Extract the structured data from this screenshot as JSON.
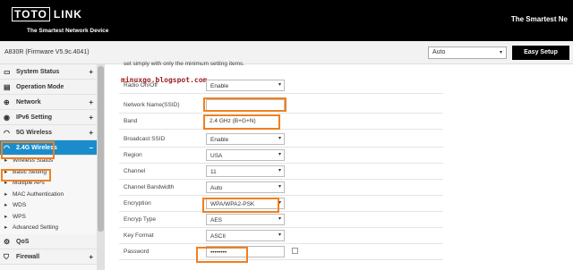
{
  "header": {
    "logo_left": "TOTO",
    "logo_right": "LINK",
    "logo_sub": "The Smartest Network Device",
    "right_title": "The Smartest Ne"
  },
  "subbar": {
    "model": "A830R (Firmware V5.9c.4041)",
    "language": "Auto",
    "easy_setup": "Easy Setup"
  },
  "sidebar": {
    "items": [
      {
        "label": "System Status",
        "icon": "monitor-icon"
      },
      {
        "label": "Operation Mode",
        "icon": "mode-icon"
      },
      {
        "label": "Network",
        "icon": "globe-icon"
      },
      {
        "label": "IPv6 Setting",
        "icon": "ipv6-icon"
      },
      {
        "label": "5G Wireless",
        "icon": "wifi-icon"
      },
      {
        "label": "2.4G Wireless",
        "icon": "wifi-icon"
      },
      {
        "label": "QoS",
        "icon": "gear-icon"
      },
      {
        "label": "Firewall",
        "icon": "shield-icon"
      }
    ],
    "plus": "+",
    "minus": "−",
    "bullet": "▸",
    "subitems": [
      "Wireless Status",
      "Basic Setting",
      "Multiple APs",
      "MAC Authentication",
      "WDS",
      "WPS",
      "Advanced Setting"
    ]
  },
  "main": {
    "intro": "set simply with only the minimum setting items.",
    "watermark": "minuxgo.blogspot.com",
    "rows": [
      {
        "label": "Radio On/Off",
        "value": "Enable",
        "dropdown": true
      },
      {
        "label": "Network Name(SSID)",
        "value": "",
        "dropdown": false
      },
      {
        "label": "Band",
        "value": "2.4 GHz (B+G+N)",
        "dropdown": false
      },
      {
        "label": "Broadcast SSID",
        "value": "Enable",
        "dropdown": true
      },
      {
        "label": "Region",
        "value": "USA",
        "dropdown": true
      },
      {
        "label": "Channel",
        "value": "11",
        "dropdown": true
      },
      {
        "label": "Channel Bandwidth",
        "value": "Auto",
        "dropdown": true
      },
      {
        "label": "Encryption",
        "value": "WPA/WPA2-PSK",
        "dropdown": true
      },
      {
        "label": "Encryp Type",
        "value": "AES",
        "dropdown": true
      },
      {
        "label": "Key Format",
        "value": "ASCII",
        "dropdown": true
      },
      {
        "label": "Password",
        "value": "••••••••",
        "dropdown": false
      }
    ],
    "arrow": "▾"
  },
  "colors": {
    "highlight": "#f08020",
    "active_menu": "#1a8ccc",
    "header_bg": "#000000"
  }
}
